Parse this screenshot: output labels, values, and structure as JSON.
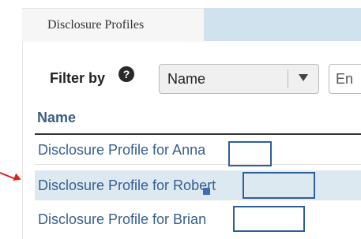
{
  "tabs": [
    {
      "label": "Disclosure Profiles",
      "active": true
    }
  ],
  "filter": {
    "label": "Filter by",
    "help_icon": "question-circle-icon",
    "selected_option": "Name",
    "input_placeholder": "En"
  },
  "table": {
    "column_header": "Name",
    "rows": [
      {
        "name": "Disclosure Profile for Anna",
        "selected": false
      },
      {
        "name": "Disclosure Profile for Robert",
        "selected": true
      },
      {
        "name": "Disclosure Profile for Brian",
        "selected": false
      }
    ]
  },
  "annotation": {
    "arrow_color": "#e0201a",
    "box_color": "#2f5f9b",
    "points_to_row": "Disclosure Profile for Robert"
  },
  "colors": {
    "link": "#365f8e",
    "header_text": "#3c5f83",
    "tabstrip": "#cfe2ee",
    "selected_row": "#dde9f1"
  }
}
